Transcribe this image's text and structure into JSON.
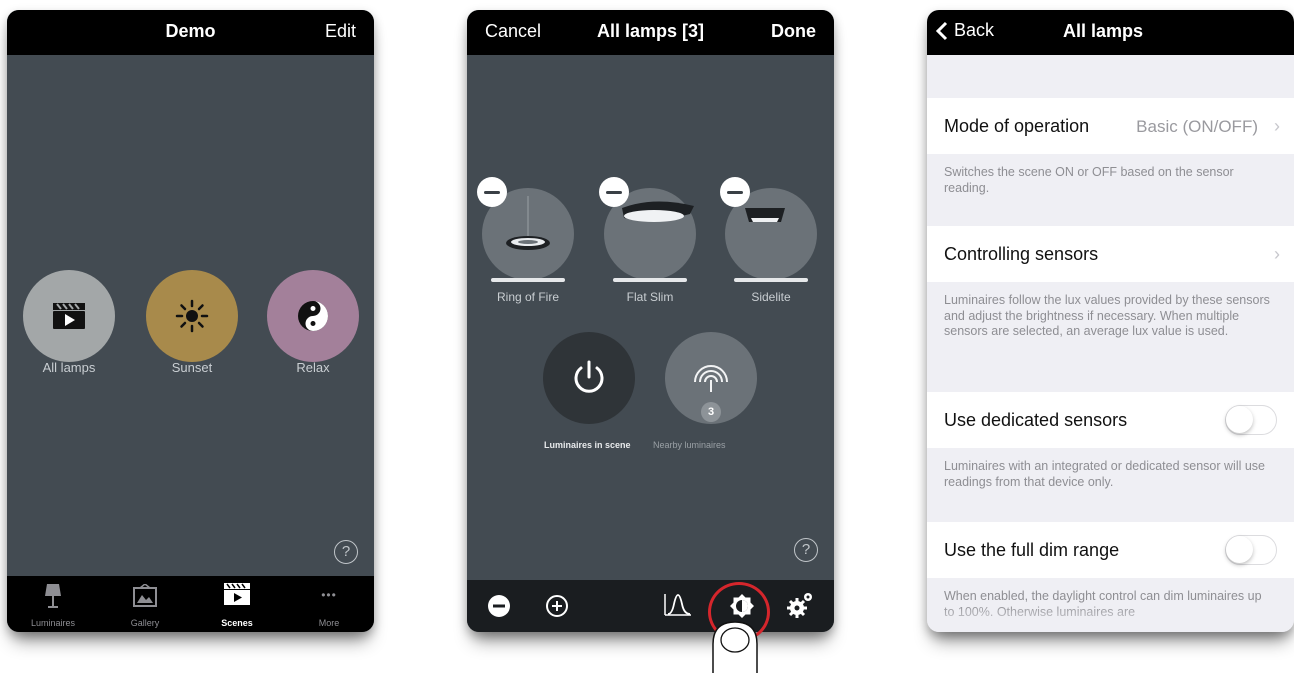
{
  "screen1": {
    "nav": {
      "title": "Demo",
      "right": "Edit"
    },
    "scenes": [
      {
        "label": "All lamps",
        "color": "#a3a7a8",
        "icon": "clapperboard-icon"
      },
      {
        "label": "Sunset",
        "color": "#a88a4b",
        "icon": "sun-icon"
      },
      {
        "label": "Relax",
        "color": "#a3809a",
        "icon": "yin-yang-icon"
      }
    ],
    "help": "?",
    "tabs": [
      {
        "label": "Luminaires",
        "icon": "lamp-icon"
      },
      {
        "label": "Gallery",
        "icon": "gallery-icon"
      },
      {
        "label": "Scenes",
        "icon": "clapperboard-icon",
        "active": true
      },
      {
        "label": "More",
        "icon": "ellipsis-icon"
      }
    ],
    "more_glyph": "•••"
  },
  "screen2": {
    "nav": {
      "left": "Cancel",
      "title": "All lamps [3]",
      "right": "Done"
    },
    "lamps": [
      {
        "label": "Ring of Fire"
      },
      {
        "label": "Flat Slim"
      },
      {
        "label": "Sidelite"
      }
    ],
    "nearby_count": "3",
    "luminaires_in_scene": "Luminaires in scene",
    "nearby_luminaires": "Nearby luminaires",
    "help": "?",
    "highlight_color": "#d5262c"
  },
  "screen3": {
    "nav": {
      "left": "Back",
      "title": "All lamps"
    },
    "mode_title": "Mode of operation",
    "mode_value": "Basic (ON/OFF)",
    "mode_note": "Switches the scene ON or OFF based on the sensor reading.",
    "controlling_title": "Controlling sensors",
    "controlling_note": "Luminaires follow the lux values provided by these sensors and adjust the brightness if necessary. When multiple sensors are selected, an average lux value is used.",
    "dedicated_title": "Use dedicated sensors",
    "dedicated_note": "Luminaires with an integrated or dedicated sensor will use readings from that device only.",
    "fulldim_title": "Use the full dim range",
    "fulldim_note": "When enabled, the daylight control can dim luminaires up to 100%. Otherwise luminaires are"
  }
}
